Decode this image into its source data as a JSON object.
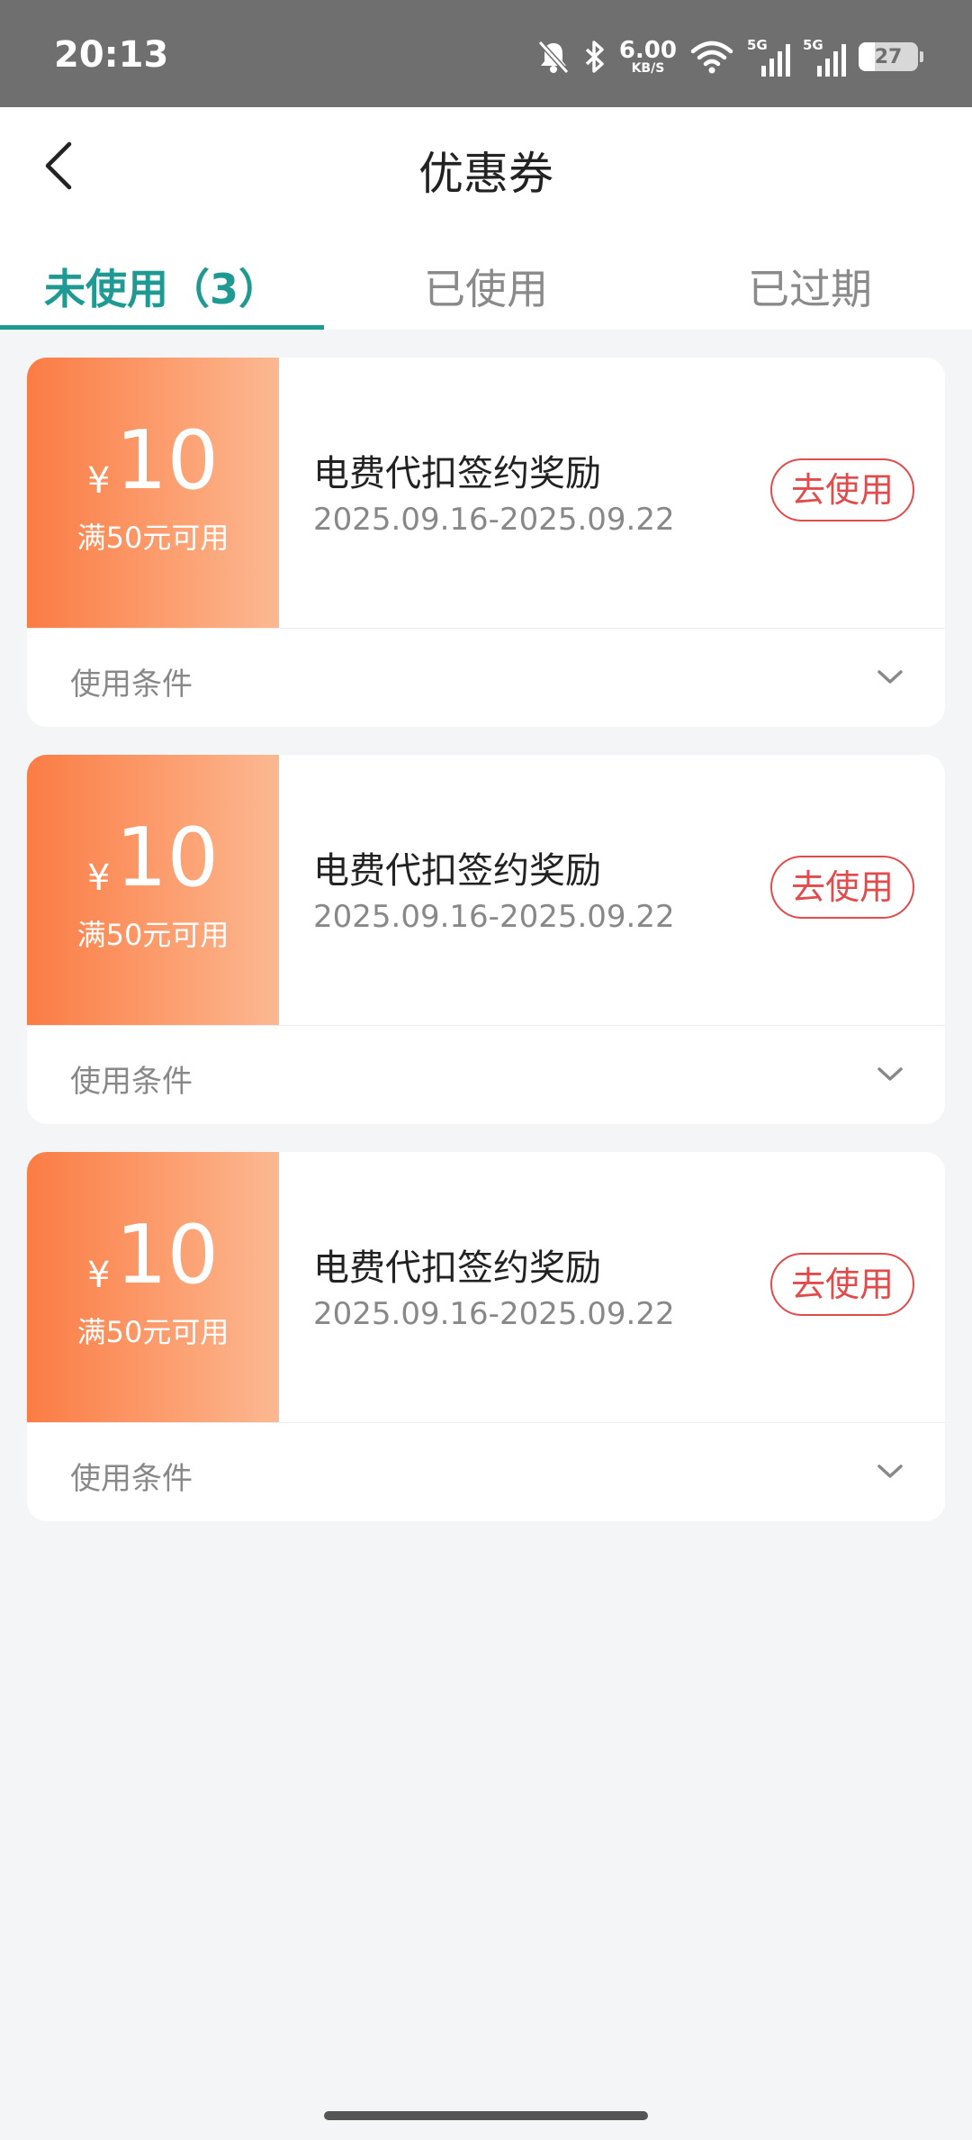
{
  "status_bar": {
    "time": "20:13",
    "net_speed_value": "6.00",
    "net_speed_unit": "KB/S",
    "signal1_label": "5G",
    "signal2_label": "5G",
    "battery_level": "27",
    "battery_fraction": 0.27,
    "icons": [
      "bell-off-icon",
      "bluetooth-icon",
      "wifi-icon",
      "signal-icon",
      "signal-icon",
      "battery-icon"
    ]
  },
  "header": {
    "title": "优惠券",
    "back_icon": "chevron-left-icon"
  },
  "tabs": [
    {
      "label": "未使用（3）",
      "active": true
    },
    {
      "label": "已使用",
      "active": false
    },
    {
      "label": "已过期",
      "active": false
    }
  ],
  "coupons": [
    {
      "currency": "¥",
      "amount": "10",
      "condition": "满50元可用",
      "name": "电费代扣签约奖励",
      "date_range": "2025.09.16-2025.09.22",
      "button": "去使用",
      "terms_label": "使用条件"
    },
    {
      "currency": "¥",
      "amount": "10",
      "condition": "满50元可用",
      "name": "电费代扣签约奖励",
      "date_range": "2025.09.16-2025.09.22",
      "button": "去使用",
      "terms_label": "使用条件"
    },
    {
      "currency": "¥",
      "amount": "10",
      "condition": "满50元可用",
      "name": "电费代扣签约奖励",
      "date_range": "2025.09.16-2025.09.22",
      "button": "去使用",
      "terms_label": "使用条件"
    }
  ],
  "colors": {
    "accent": "#1f9a93",
    "coupon_gradient_start": "#fb7c44",
    "coupon_gradient_end": "#fcb891",
    "use_button": "#e14b4b",
    "status_bar": "#6f6f6f",
    "background": "#f4f5f7"
  }
}
